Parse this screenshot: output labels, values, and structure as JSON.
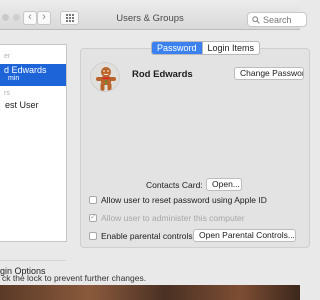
{
  "window": {
    "title": "Users & Groups"
  },
  "toolbar": {
    "back_icon": "chevron-left-icon",
    "forward_icon": "chevron-right-icon",
    "grid_icon": "grid-icon"
  },
  "search": {
    "placeholder": "Search"
  },
  "sidebar": {
    "section_current": "Current User",
    "section_current_visible": "er",
    "selected_user": {
      "name": "d Edwards",
      "role": "min"
    },
    "section_other": "Other Users",
    "section_other_visible": "rs",
    "guest": "est User",
    "login_options": "gin Options"
  },
  "tabs": [
    {
      "label": "Password",
      "active": true
    },
    {
      "label": "Login Items",
      "active": false
    }
  ],
  "user": {
    "name": "Rod Edwards",
    "avatar_icon": "gingerbread-man-icon"
  },
  "buttons": {
    "change_password": "Change Password...",
    "open": "Open...",
    "open_parental": "Open Parental Controls..."
  },
  "contacts_card_label": "Contacts Card:",
  "checkboxes": [
    {
      "label": "Allow user to reset password using Apple ID",
      "checked": false,
      "enabled": true
    },
    {
      "label": "Allow user to administer this computer",
      "checked": true,
      "enabled": false
    },
    {
      "label": "Enable parental controls",
      "checked": false,
      "enabled": true
    }
  ],
  "footer": {
    "lock_text": "ck the lock to prevent further changes."
  },
  "colors": {
    "selection": "#1d64d8",
    "active_tab": "#3b82f0"
  }
}
